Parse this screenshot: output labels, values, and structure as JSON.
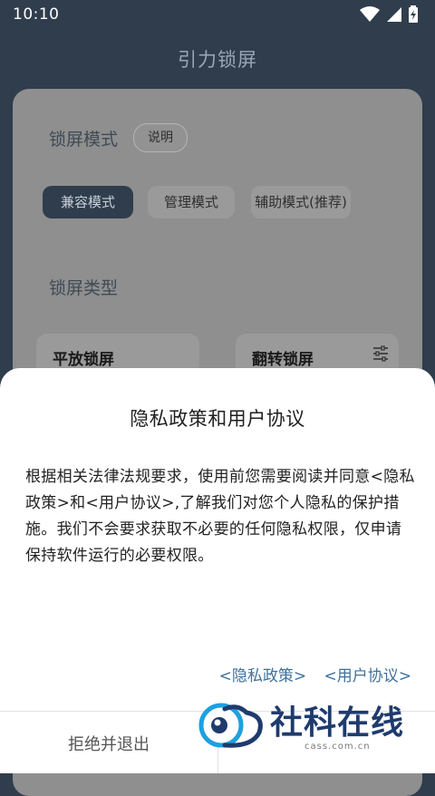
{
  "status_bar": {
    "time": "10:10"
  },
  "app": {
    "title": "引力锁屏"
  },
  "background": {
    "lock_mode_label": "锁屏模式",
    "explain_chip": "说明",
    "modes": [
      "兼容模式",
      "管理模式",
      "辅助模式(推荐)"
    ],
    "selected_mode": "兼容模式",
    "lock_type_label": "锁屏类型",
    "types": [
      "平放锁屏",
      "翻转锁屏"
    ]
  },
  "dialog": {
    "title": "隐私政策和用户协议",
    "body": "根据相关法律法规要求，使用前您需要阅读并同意<隐私政策>和<用户协议>,了解我们对您个人隐私的保护措施。我们不会要求获取不必要的任何隐私权限，仅申请保持软件运行的必要权限。",
    "privacy_link": "<隐私政策>",
    "user_agreement_link": "<用户协议>",
    "reject_button": "拒绝并退出"
  },
  "watermark": {
    "text": "社科在线",
    "sub": "cass.com.cn"
  },
  "colors": {
    "status_bg": "#2f3d4d",
    "dim_card": "#8f8f8f",
    "selected_pill": "#2f3d4d",
    "link": "#3f6f9a",
    "watermark_blue": "#1f3b6e",
    "watermark_cyan": "#1ea0e0"
  },
  "icons": [
    "wifi-icon",
    "signal-icon",
    "battery-charging-icon",
    "settings-sliders-icon"
  ]
}
